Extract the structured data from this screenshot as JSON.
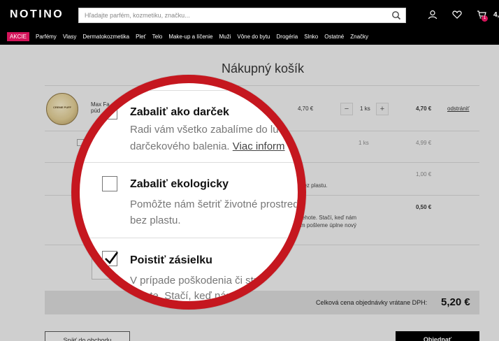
{
  "header": {
    "logo": "NOTINO",
    "search_placeholder": "Hľadajte parfém, kozmetiku, značku...",
    "cart_count": "1",
    "cart_price": "4,"
  },
  "nav": [
    "AKCIE",
    "Parfémy",
    "Vlasy",
    "Dermatokozmetika",
    "Pleť",
    "Telo",
    "Make-up a líčenie",
    "Muži",
    "Vône do bytu",
    "Drogéria",
    "Slnko",
    "Ostatné",
    "Značky"
  ],
  "page_title": "Nákupný košík",
  "product": {
    "image_text": "CREME PUFF",
    "name": "Max Fa",
    "name2": "púd",
    "unit_price": "4,70 €",
    "qty": "1",
    "qty_unit": "ks",
    "total": "4,70 €",
    "remove": "odstrániť",
    "minus": "−",
    "plus": "+"
  },
  "gift_row": {
    "qty": "1",
    "qty_unit": "ks",
    "price": "4,99 €"
  },
  "eco_row": {
    "price": "1,00 €",
    "desc_tail": "bez plastu."
  },
  "insure_row": {
    "price": "0,50 €",
    "desc_line1": "lehote. Stačí, keď nám",
    "desc_line2": "m pošleme úplne nový"
  },
  "total": {
    "label": "Celková cena objednávky vrátane DPH:",
    "value": "5,20 €"
  },
  "buttons": {
    "back": "Späť do obchodu",
    "order": "Objednať"
  },
  "magnifier": {
    "gift_title": "Zabaliť ako darček",
    "gift_desc1": "Radi vám všetko zabalíme do lu",
    "gift_desc2": "darčekového balenia.",
    "gift_link": "Viac inform",
    "eco_title": "Zabaliť ekologicky",
    "eco_desc1": "Pomôžte nám šetriť životné prostred",
    "eco_desc2": "bez plastu.",
    "insure_title": "Poistiť zásielku",
    "insure_desc1": "V prípade poškodenia či stra",
    "insure_desc2": "lehote. Stačí, keď nám"
  },
  "colors": {
    "accent": "#d4145a",
    "magnifier_ring": "#c5171f"
  }
}
